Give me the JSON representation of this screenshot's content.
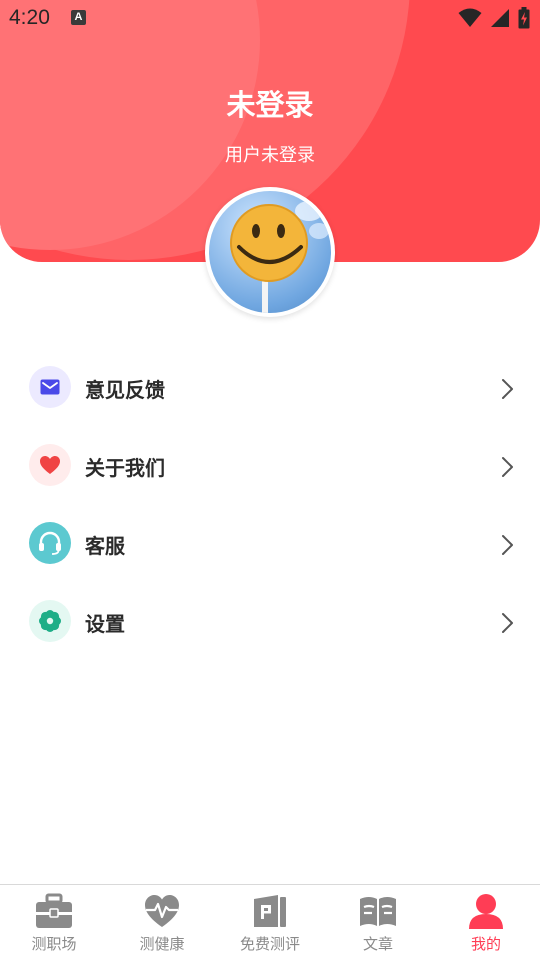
{
  "status_bar": {
    "time": "4:20",
    "notification_icon": "a-letter-icon",
    "icons": [
      "wifi-icon",
      "signal-icon",
      "battery-charging-icon"
    ]
  },
  "header": {
    "title": "未登录",
    "subtitle": "用户未登录",
    "background_color": "#ff4a4f"
  },
  "menu": {
    "items": [
      {
        "label": "意见反馈",
        "icon": "mail-icon",
        "icon_bg": "#eceaff",
        "icon_color": "#4a4ae8"
      },
      {
        "label": "关于我们",
        "icon": "heart-icon",
        "icon_bg": "#ffecec",
        "icon_color": "#f04444"
      },
      {
        "label": "客服",
        "icon": "headset-icon",
        "icon_bg": "#5cc9d0",
        "icon_color": "#ffffff"
      },
      {
        "label": "设置",
        "icon": "flower-gear-icon",
        "icon_bg": "#e4f8f2",
        "icon_color": "#1eae87"
      }
    ]
  },
  "bottom_nav": {
    "active_index": 4,
    "active_color": "#ff3d55",
    "items": [
      {
        "label": "测职场",
        "icon": "briefcase-icon"
      },
      {
        "label": "测健康",
        "icon": "heart-pulse-icon"
      },
      {
        "label": "免费测评",
        "icon": "form-icon"
      },
      {
        "label": "文章",
        "icon": "open-book-icon"
      },
      {
        "label": "我的",
        "icon": "person-icon"
      }
    ]
  }
}
